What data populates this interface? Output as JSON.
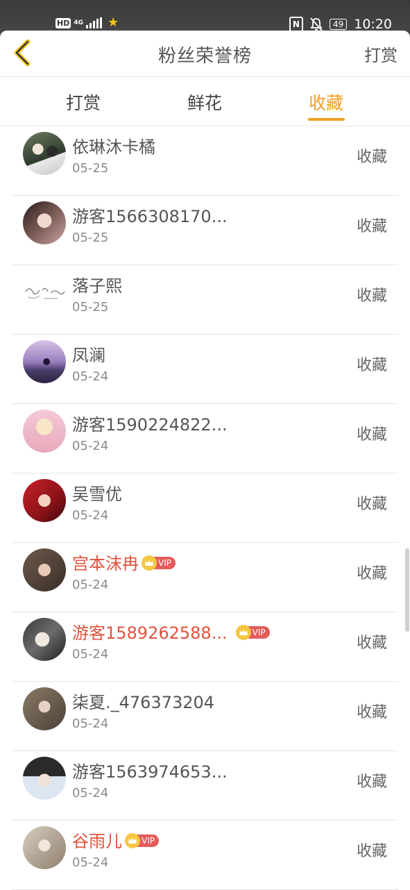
{
  "statusbar": {
    "hd": "HD",
    "net": "4G",
    "battery": "49",
    "time": "10:20"
  },
  "header": {
    "title": "粉丝荣誉榜",
    "action": "打赏"
  },
  "tabs": [
    {
      "label": "打赏",
      "active": false
    },
    {
      "label": "鲜花",
      "active": false
    },
    {
      "label": "收藏",
      "active": true
    }
  ],
  "colors": {
    "accent": "#f0a022",
    "vip_name": "#e0533c"
  },
  "list": [
    {
      "name": "依琳沐卡橘",
      "date": "05-25",
      "tag": "收藏",
      "vip": false
    },
    {
      "name": "游客1566308170...",
      "date": "05-25",
      "tag": "收藏",
      "vip": false
    },
    {
      "name": "落子熙",
      "date": "05-25",
      "tag": "收藏",
      "vip": false
    },
    {
      "name": "凤澜",
      "date": "05-24",
      "tag": "收藏",
      "vip": false
    },
    {
      "name": "游客1590224822...",
      "date": "05-24",
      "tag": "收藏",
      "vip": false
    },
    {
      "name": "吴雪优",
      "date": "05-24",
      "tag": "收藏",
      "vip": false
    },
    {
      "name": "宫本沫冉",
      "date": "05-24",
      "tag": "收藏",
      "vip": true,
      "vip_label": "VIP"
    },
    {
      "name": "游客1589262588...",
      "date": "05-24",
      "tag": "收藏",
      "vip": true,
      "vip_label": "VIP"
    },
    {
      "name": "柒夏._476373204",
      "date": "05-24",
      "tag": "收藏",
      "vip": false
    },
    {
      "name": "游客1563974653...",
      "date": "05-24",
      "tag": "收藏",
      "vip": false
    },
    {
      "name": "谷雨儿",
      "date": "05-24",
      "tag": "收藏",
      "vip": true,
      "vip_label": "VIP"
    }
  ]
}
